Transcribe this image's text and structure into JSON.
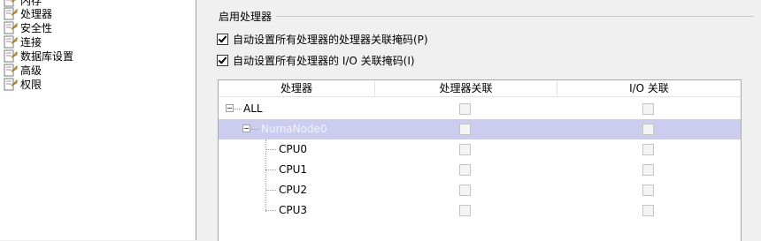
{
  "nav": {
    "items": [
      {
        "label": "内存"
      },
      {
        "label": "处理器"
      },
      {
        "label": "安全性"
      },
      {
        "label": "连接"
      },
      {
        "label": "数据库设置"
      },
      {
        "label": "高级"
      },
      {
        "label": "权限"
      }
    ]
  },
  "section": {
    "title": "启用处理器"
  },
  "options": {
    "auto_processor_affinity": {
      "label": "自动设置所有处理器的处理器关联掩码(P)",
      "checked": true
    },
    "auto_io_affinity": {
      "label": "自动设置所有处理器的 I/O 关联掩码(I)",
      "checked": true
    }
  },
  "grid": {
    "columns": [
      "处理器",
      "处理器关联",
      "I/O 关联"
    ],
    "rows": [
      {
        "name": "ALL",
        "processor_affinity": false,
        "io_affinity": false,
        "expanded": true
      },
      {
        "name": "NumaNode0",
        "processor_affinity": false,
        "io_affinity": false,
        "expanded": true,
        "selected": true
      },
      {
        "name": "CPU0",
        "processor_affinity": false,
        "io_affinity": false
      },
      {
        "name": "CPU1",
        "processor_affinity": false,
        "io_affinity": false
      },
      {
        "name": "CPU2",
        "processor_affinity": false,
        "io_affinity": false
      },
      {
        "name": "CPU3",
        "processor_affinity": false,
        "io_affinity": false
      }
    ]
  },
  "colors": {
    "selected_row": "#ccccee",
    "grid_border": "#a9a9a9"
  }
}
